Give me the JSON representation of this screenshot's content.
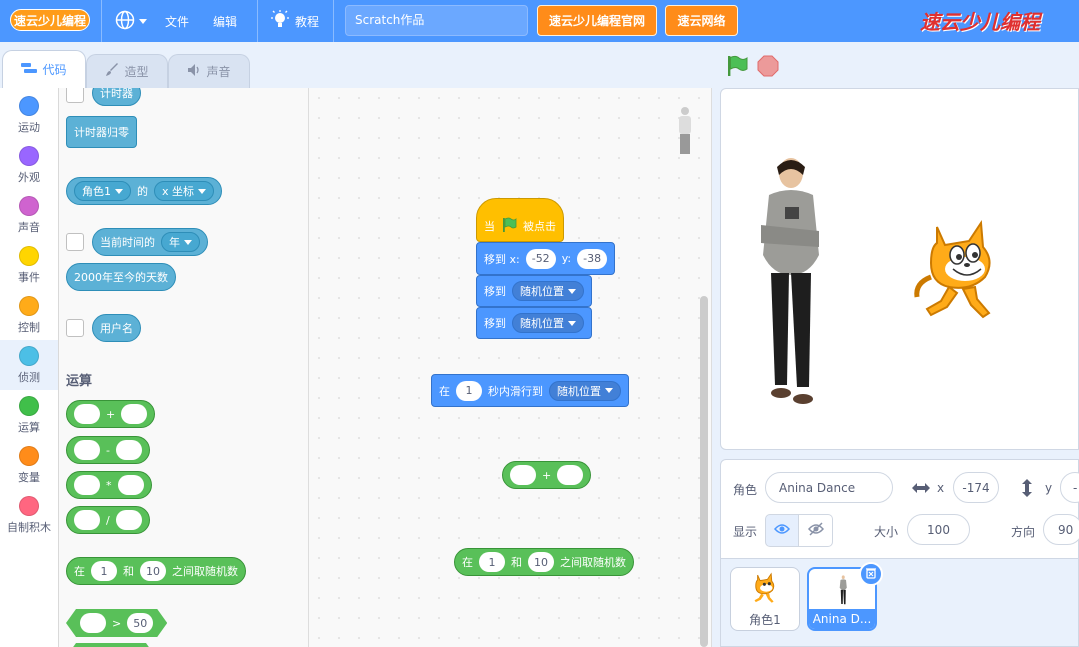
{
  "header": {
    "logo_text": "速云少儿编程",
    "menu_file": "文件",
    "menu_edit": "编辑",
    "menu_tutorials": "教程",
    "project_title": "Scratch作品",
    "official_site_button": "速云少儿编程官网",
    "network_button": "速云网络",
    "brand_text": "速云少儿编程"
  },
  "tabs": {
    "code": "代码",
    "costumes": "造型",
    "sounds": "声音"
  },
  "categories": [
    {
      "label": "运动",
      "color": "#4c97ff"
    },
    {
      "label": "外观",
      "color": "#9966ff"
    },
    {
      "label": "声音",
      "color": "#cf63cf"
    },
    {
      "label": "事件",
      "color": "#ffd500"
    },
    {
      "label": "控制",
      "color": "#ffab19"
    },
    {
      "label": "侦测",
      "color": "#4cbfe6"
    },
    {
      "label": "运算",
      "color": "#40bf4a"
    },
    {
      "label": "变量",
      "color": "#ff8c1a"
    },
    {
      "label": "自制积木",
      "color": "#ff6680"
    }
  ],
  "palette": {
    "timer": "计时器",
    "reset_timer": "计时器归零",
    "of_sprite": "角色1",
    "of_label": "的",
    "of_attr": "x 坐标",
    "current_label": "当前时间的",
    "current_value": "年",
    "days_since": "2000年至今的天数",
    "username": "用户名",
    "operators_header": "运算",
    "plus": "+",
    "minus": "-",
    "times": "*",
    "divide": "/",
    "random_in": "在",
    "random_from": "1",
    "random_and": "和",
    "random_to": "10",
    "random_label": "之间取随机数",
    "gt_symbol": ">",
    "gt_value": "50"
  },
  "script": {
    "hat_when": "当",
    "hat_clicked": "被点击",
    "goto_label": "移到 x:",
    "goto_x": "-52",
    "goto_y_label": "y:",
    "goto_y": "-38",
    "goto2_label": "移到",
    "goto2_value": "随机位置",
    "goto3_label": "移到",
    "goto3_value": "随机位置",
    "glide_in": "在",
    "glide_secs": "1",
    "glide_label": "秒内滑行到",
    "glide_target": "随机位置",
    "plus": "+",
    "rand_in": "在",
    "rand_from": "1",
    "rand_and": "和",
    "rand_to": "10",
    "rand_label": "之间取随机数"
  },
  "sprite_info": {
    "sprite_label": "角色",
    "sprite_name": "Anina Dance",
    "x_label": "x",
    "x_value": "-174",
    "y_label": "y",
    "y_value": "-",
    "show_label": "显示",
    "size_label": "大小",
    "size_value": "100",
    "direction_label": "方向",
    "direction_value": "90"
  },
  "sprite_list": [
    {
      "name": "角色1"
    },
    {
      "name": "Anina D..."
    }
  ]
}
